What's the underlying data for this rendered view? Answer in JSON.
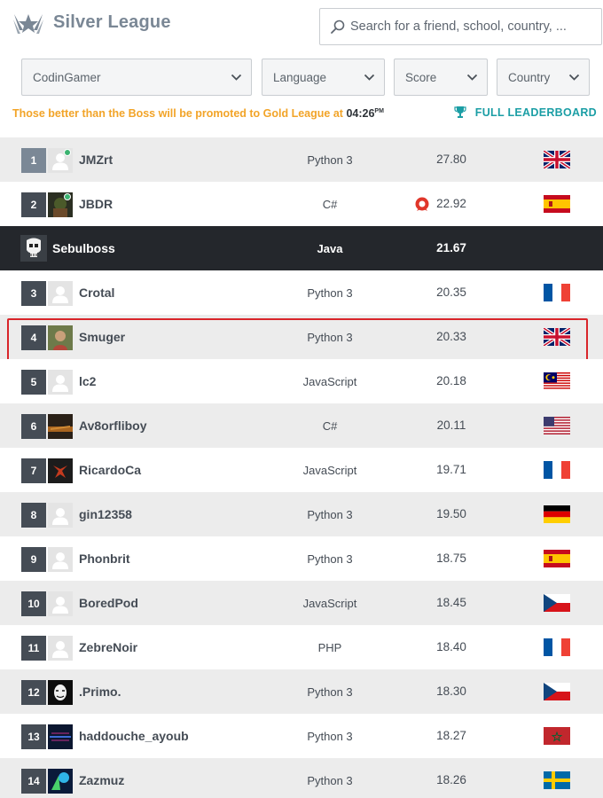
{
  "header": {
    "league_title": "Silver League",
    "logo_icon": "league-wings-icon",
    "search": {
      "placeholder": "Search for a friend, school, country, ...",
      "value": ""
    }
  },
  "filters": [
    {
      "key": "codingamer",
      "label": "CodinGamer"
    },
    {
      "key": "language",
      "label": "Language"
    },
    {
      "key": "score",
      "label": "Score"
    },
    {
      "key": "country",
      "label": "Country"
    }
  ],
  "promo": {
    "text": "Those better than the Boss will be promoted to Gold League at",
    "time": "04:26",
    "time_suffix": "PM"
  },
  "full_leaderboard_label": "FULL LEADERBOARD",
  "colors": {
    "accent_teal": "#1b9ea5",
    "promo_orange": "#f2a428",
    "boss_row": "#24272c",
    "selected_outline": "#d9252a"
  },
  "rows": [
    {
      "rank": "1",
      "name": "JMZrt",
      "language": "Python 3",
      "score": "27.80",
      "country": "United Kingdom",
      "flag": "gb",
      "online": true
    },
    {
      "rank": "2",
      "name": "JBDR",
      "language": "C#",
      "score": "22.92",
      "country": "Spain",
      "flag": "es",
      "online": true,
      "badge": "red-badge-icon"
    },
    {
      "rank": "",
      "name": "Sebulboss",
      "language": "Java",
      "score": "21.67",
      "boss": true
    },
    {
      "rank": "3",
      "name": "Crotal",
      "language": "Python 3",
      "score": "20.35",
      "country": "France",
      "flag": "fr"
    },
    {
      "rank": "4",
      "name": "Smuger",
      "language": "Python 3",
      "score": "20.33",
      "country": "United Kingdom",
      "flag": "gb",
      "selected": true
    },
    {
      "rank": "5",
      "name": "lc2",
      "language": "JavaScript",
      "score": "20.18",
      "country": "Malaysia",
      "flag": "my"
    },
    {
      "rank": "6",
      "name": "Av8orfliboy",
      "language": "C#",
      "score": "20.11",
      "country": "United States",
      "flag": "us"
    },
    {
      "rank": "7",
      "name": "RicardoCa",
      "language": "JavaScript",
      "score": "19.71",
      "country": "France",
      "flag": "fr"
    },
    {
      "rank": "8",
      "name": "gin12358",
      "language": "Python 3",
      "score": "19.50",
      "country": "Germany",
      "flag": "de"
    },
    {
      "rank": "9",
      "name": "Phonbrit",
      "language": "Python 3",
      "score": "18.75",
      "country": "Spain",
      "flag": "es"
    },
    {
      "rank": "10",
      "name": "BoredPod",
      "language": "JavaScript",
      "score": "18.45",
      "country": "Czech Republic",
      "flag": "cz"
    },
    {
      "rank": "11",
      "name": "ZebreNoir",
      "language": "PHP",
      "score": "18.40",
      "country": "France",
      "flag": "fr"
    },
    {
      "rank": "12",
      "name": ".Primo.",
      "language": "Python 3",
      "score": "18.30",
      "country": "Czech Republic",
      "flag": "cz"
    },
    {
      "rank": "13",
      "name": "haddouche_ayoub",
      "language": "Python 3",
      "score": "18.27",
      "country": "Morocco",
      "flag": "ma"
    },
    {
      "rank": "14",
      "name": "Zazmuz",
      "language": "Python 3",
      "score": "18.26",
      "country": "Sweden",
      "flag": "se"
    }
  ]
}
